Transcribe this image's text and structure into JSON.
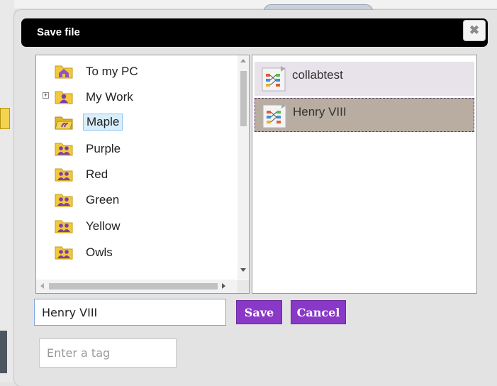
{
  "dialog": {
    "title": "Save file",
    "close_glyph": "✖"
  },
  "tree": {
    "items": [
      {
        "label": "To my PC",
        "icon": "home-folder-icon",
        "selected": false,
        "expandable": false
      },
      {
        "label": "My Work",
        "icon": "user-folder-icon",
        "selected": false,
        "expandable": true,
        "expander_glyph": "+"
      },
      {
        "label": "Maple",
        "icon": "open-folder-icon",
        "selected": true,
        "expandable": false
      },
      {
        "label": "Purple",
        "icon": "group-folder-icon",
        "selected": false,
        "expandable": false
      },
      {
        "label": "Red",
        "icon": "group-folder-icon",
        "selected": false,
        "expandable": false
      },
      {
        "label": "Green",
        "icon": "group-folder-icon",
        "selected": false,
        "expandable": false
      },
      {
        "label": "Yellow",
        "icon": "group-folder-icon",
        "selected": false,
        "expandable": false
      },
      {
        "label": "Owls",
        "icon": "group-folder-icon",
        "selected": false,
        "expandable": false
      }
    ]
  },
  "files": {
    "items": [
      {
        "label": "collabtest",
        "icon": "flipchart-file-icon",
        "selected": false
      },
      {
        "label": "Henry VIII",
        "icon": "flipchart-file-icon",
        "selected": true
      }
    ]
  },
  "form": {
    "filename_value": "Henry VIII",
    "save_label": "Save",
    "cancel_label": "Cancel",
    "tag_placeholder": "Enter a tag"
  },
  "colors": {
    "button_purple": "#8a38c8",
    "titlebar": "#000000",
    "selected_file_bg": "#b9ada2",
    "selected_tree_bg": "#d9eefc"
  }
}
